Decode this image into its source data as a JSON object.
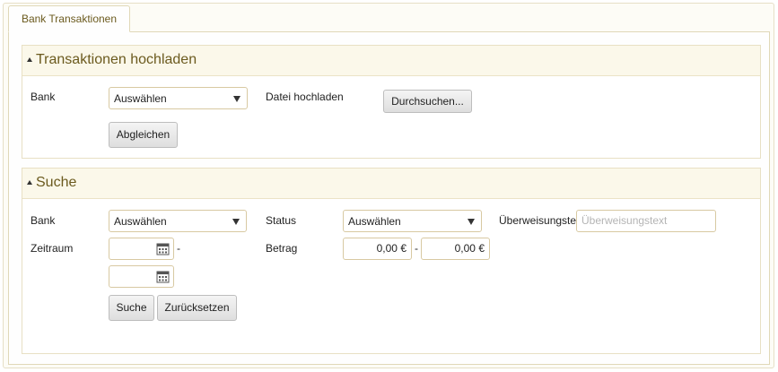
{
  "tab": {
    "label": "Bank Transaktionen"
  },
  "upload": {
    "title": "Transaktionen hochladen",
    "bank_label": "Bank",
    "bank_value": "Auswählen",
    "file_label": "Datei hochladen",
    "browse_button": "Durchsuchen...",
    "reconcile_button": "Abgleichen"
  },
  "search": {
    "title": "Suche",
    "bank_label": "Bank",
    "bank_value": "Auswählen",
    "status_label": "Status",
    "status_value": "Auswählen",
    "transfer_label": "Überweisungstext",
    "transfer_placeholder": "Überweisungstext",
    "period_label": "Zeitraum",
    "amount_label": "Betrag",
    "amount_from": "0,00 €",
    "amount_to": "0,00 €",
    "dash": "-",
    "search_button": "Suche",
    "reset_button": "Zurücksetzen"
  },
  "colors": {
    "accent": "#6b5a1e",
    "border": "#d8c9a2"
  },
  "icons": {
    "calendar": "calendar-icon",
    "collapse": "collapse-triangle-icon",
    "dropdown": "chevron-down-icon"
  }
}
